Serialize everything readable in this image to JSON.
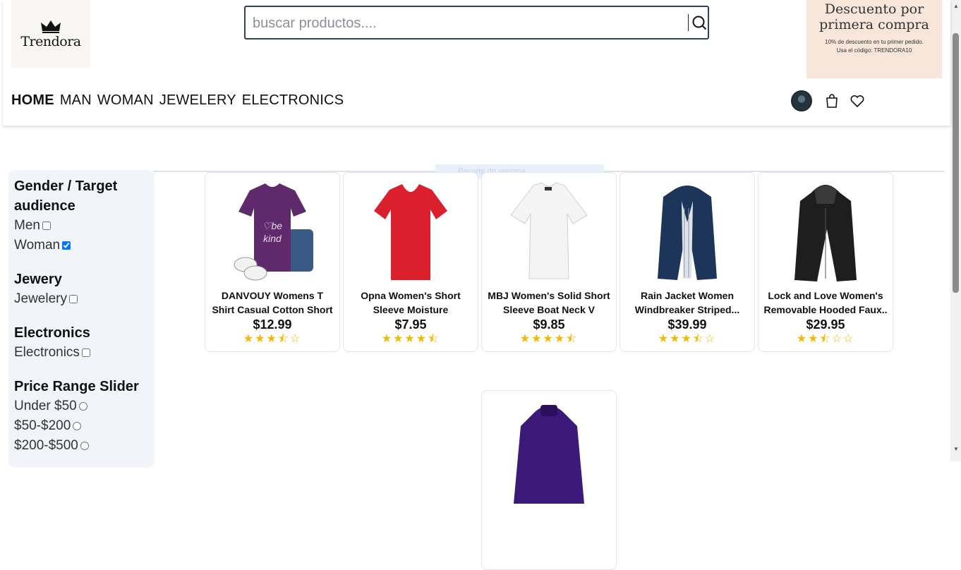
{
  "brand": {
    "name": "Trendora"
  },
  "search": {
    "placeholder": "buscar productos...."
  },
  "promo": {
    "title_line1": "Descuento por",
    "title_line2": "primera compra",
    "subtitle_line1": "10% de descuento en tu primer pedido.",
    "subtitle_line2": "Usa el código: TRENDORA10"
  },
  "nav": {
    "items": [
      {
        "label": "HOME",
        "active": true
      },
      {
        "label": "MAN",
        "active": false
      },
      {
        "label": "WOMAN",
        "active": false
      },
      {
        "label": "JEWELERY",
        "active": false
      },
      {
        "label": "ELECTRONICS",
        "active": false
      }
    ]
  },
  "ghost_text": "Recorte de ventana",
  "sidebar": {
    "groups": [
      {
        "title": "Gender / Target audience",
        "options": [
          {
            "label": "Men",
            "checked": false
          },
          {
            "label": "Woman",
            "checked": true
          }
        ]
      },
      {
        "title": "Jewery",
        "options": [
          {
            "label": "Jewelery",
            "checked": false
          }
        ]
      },
      {
        "title": "Electronics",
        "options": [
          {
            "label": "Electronics",
            "checked": false
          }
        ]
      },
      {
        "title": "Price Range Slider",
        "options": [
          {
            "label": "Under $50"
          },
          {
            "label": "$50-$200"
          },
          {
            "label": "$200-$500"
          }
        ]
      }
    ]
  },
  "products": [
    {
      "title": "DANVOUY Womens T Shirt Casual Cotton Short",
      "price": "$12.99",
      "rating": 3.5,
      "stars": "★★★⯪☆"
    },
    {
      "title": "Opna Women's Short Sleeve Moisture",
      "price": "$7.95",
      "rating": 4.5,
      "stars": "★★★★⯪"
    },
    {
      "title": "MBJ Women's Solid Short Sleeve Boat Neck V",
      "price": "$9.85",
      "rating": 4.5,
      "stars": "★★★★⯪"
    },
    {
      "title": "Rain Jacket Women Windbreaker Striped...",
      "price": "$39.99",
      "rating": 3.5,
      "stars": "★★★⯪☆"
    },
    {
      "title": "Lock and Love Women's Removable Hooded Faux..",
      "price": "$29.95",
      "rating": 2.5,
      "stars": "★★⯪☆☆"
    }
  ],
  "colors": {
    "accent": "#334155",
    "promo_bg": "#f8e6da",
    "sidebar_bg": "#f1f4f8",
    "star": "#f5b800"
  }
}
